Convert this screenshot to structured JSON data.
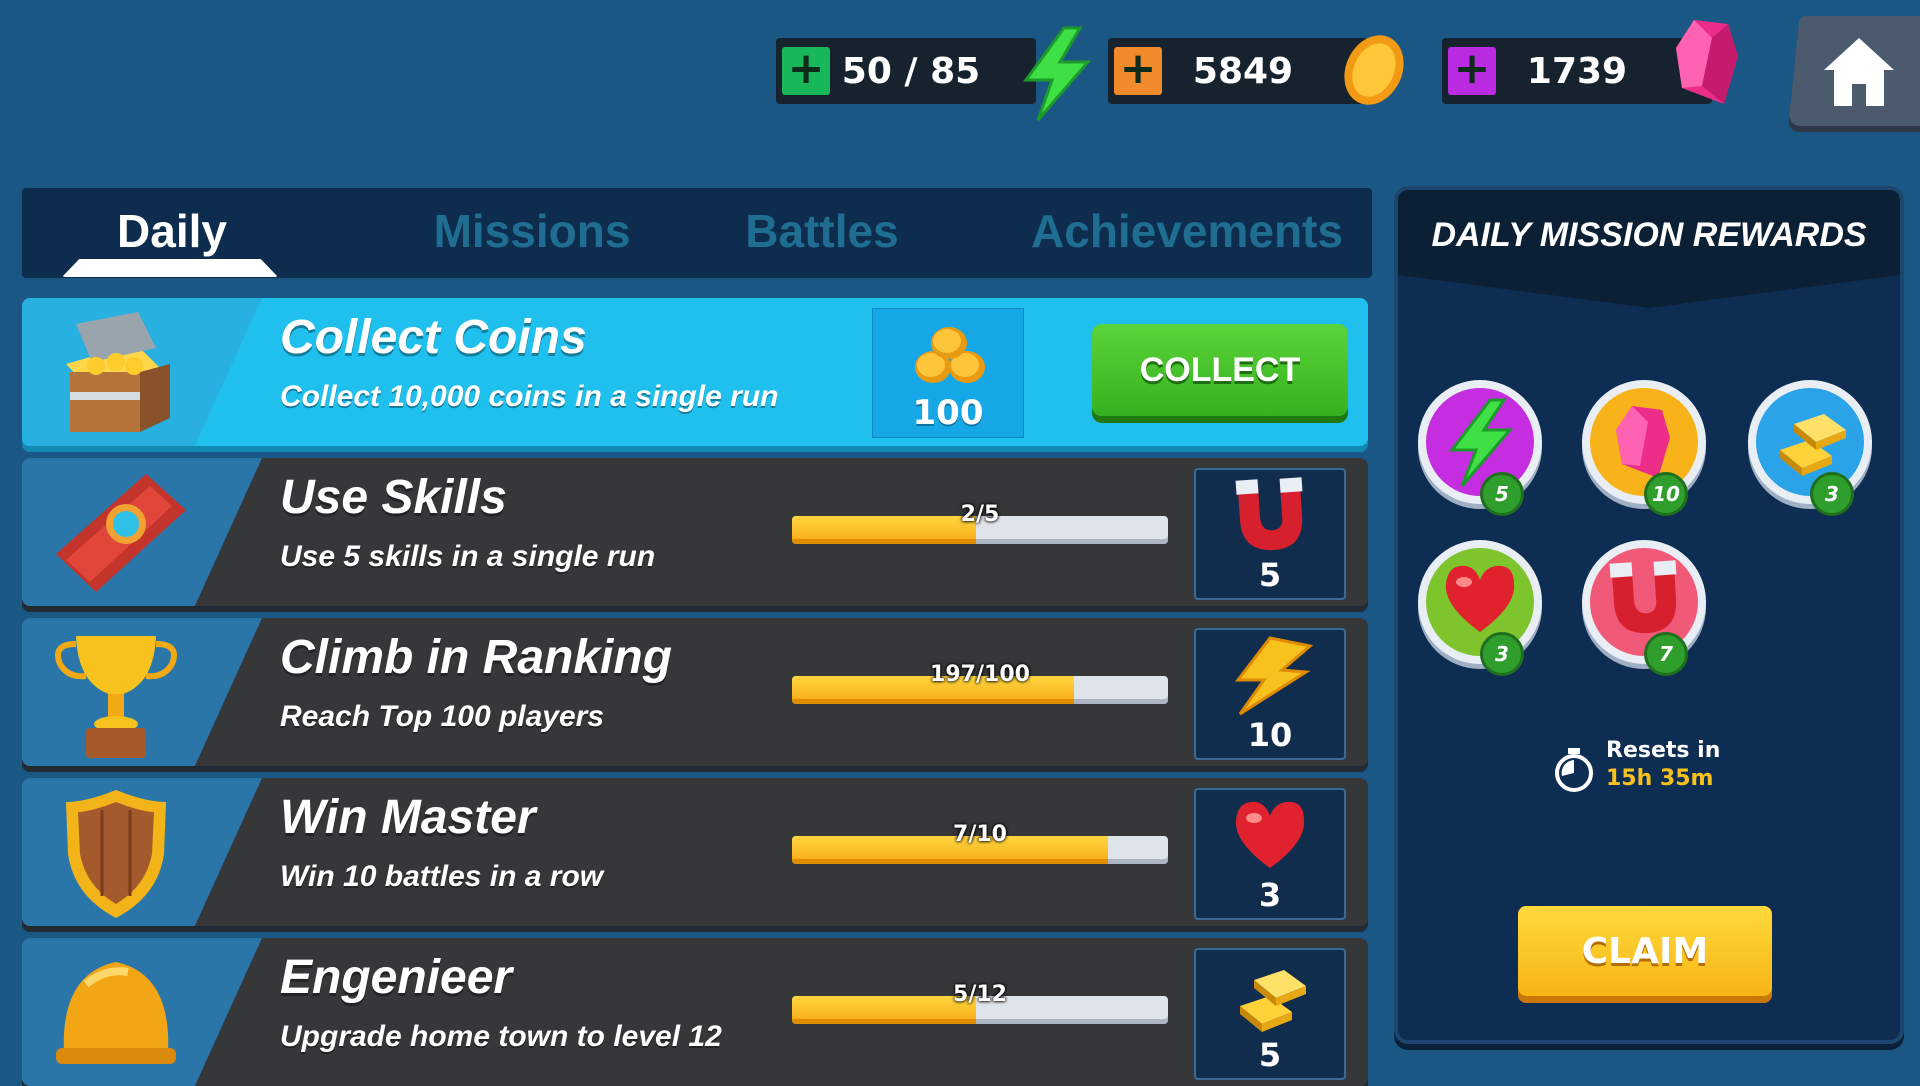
{
  "resources": {
    "energy": {
      "value": "50 / 85",
      "icon": "lightning-icon",
      "plus_color": "#17b75a"
    },
    "coins": {
      "value": "5849",
      "icon": "coin-icon",
      "plus_color": "#f08a2a"
    },
    "gems": {
      "value": "1739",
      "icon": "gem-icon",
      "plus_color": "#b92ae0"
    }
  },
  "tabs": [
    {
      "label": "Daily",
      "active": true
    },
    {
      "label": "Missions",
      "active": false
    },
    {
      "label": "Battles",
      "active": false
    },
    {
      "label": "Achievements",
      "active": false
    }
  ],
  "missions": [
    {
      "title": "Collect Coins",
      "description": "Collect 10,000 coins in a single run",
      "icon": "treasure-chest-icon",
      "reward_amount": "100",
      "reward_icon": "coins-icon",
      "button": "COLLECT",
      "completed": true
    },
    {
      "title": "Use Skills",
      "description": "Use 5 skills in a single run",
      "icon": "skill-book-icon",
      "progress_text": "2/5",
      "progress": 0.49,
      "reward_icon": "magnet-icon",
      "reward_amount": "5"
    },
    {
      "title": "Climb in Ranking",
      "description": "Reach Top 100 players",
      "icon": "trophy-icon",
      "progress_text": "197/100",
      "progress": 0.75,
      "reward_icon": "lightning-icon",
      "reward_amount": "10"
    },
    {
      "title": "Win Master",
      "description": "Win 10 battles in a row",
      "icon": "shield-icon",
      "progress_text": "7/10",
      "progress": 0.84,
      "reward_icon": "heart-icon",
      "reward_amount": "3"
    },
    {
      "title": "Engenieer",
      "description": "Upgrade home town to level 12",
      "icon": "hard-hat-icon",
      "progress_text": "5/12",
      "progress": 0.49,
      "reward_icon": "gold-bars-icon",
      "reward_amount": "5"
    }
  ],
  "panel": {
    "title": "DAILY MISSION REWARDS",
    "rewards": [
      {
        "icon": "lightning-icon",
        "amount": "5",
        "color": "#c52ee0"
      },
      {
        "icon": "gem-icon",
        "amount": "10",
        "color": "#f7b319"
      },
      {
        "icon": "gold-bars-icon",
        "amount": "3",
        "color": "#2aa3e8"
      },
      {
        "icon": "heart-icon",
        "amount": "3",
        "color": "#7ec42c"
      },
      {
        "icon": "magnet-icon",
        "amount": "7",
        "color": "#f05a78"
      }
    ],
    "resets_label": "Resets in",
    "resets_time": "15h 35m",
    "claim": "CLAIM"
  }
}
